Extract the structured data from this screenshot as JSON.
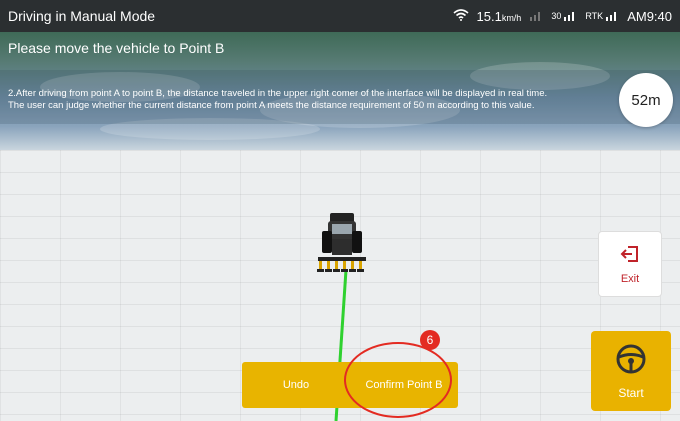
{
  "status_bar": {
    "title": "Driving in Manual Mode",
    "speed": "15.1",
    "speed_unit": "km/h",
    "signal_count_label": "30",
    "rtk_label": "RTK",
    "time": "AM9:40"
  },
  "instruction": {
    "title": "Please move the vehicle to Point B",
    "line1": "2.After driving from point A to point B, the distance traveled in the upper right comer of the interface will be displayed in real time.",
    "line2": "The user can judge whether the current distance from point A meets the distance requirement of 50 m according to this value."
  },
  "distance": {
    "value": "52m"
  },
  "controls": {
    "exit_label": "Exit",
    "start_label": "Start",
    "undo_label": "Undo",
    "confirm_label": "Confirm Point B"
  },
  "annotation": {
    "step_number": "6"
  },
  "colors": {
    "accent": "#e8b400",
    "exit_red": "#c0232a",
    "annotation_red": "#e32b22",
    "path_green": "#2fd12f"
  }
}
